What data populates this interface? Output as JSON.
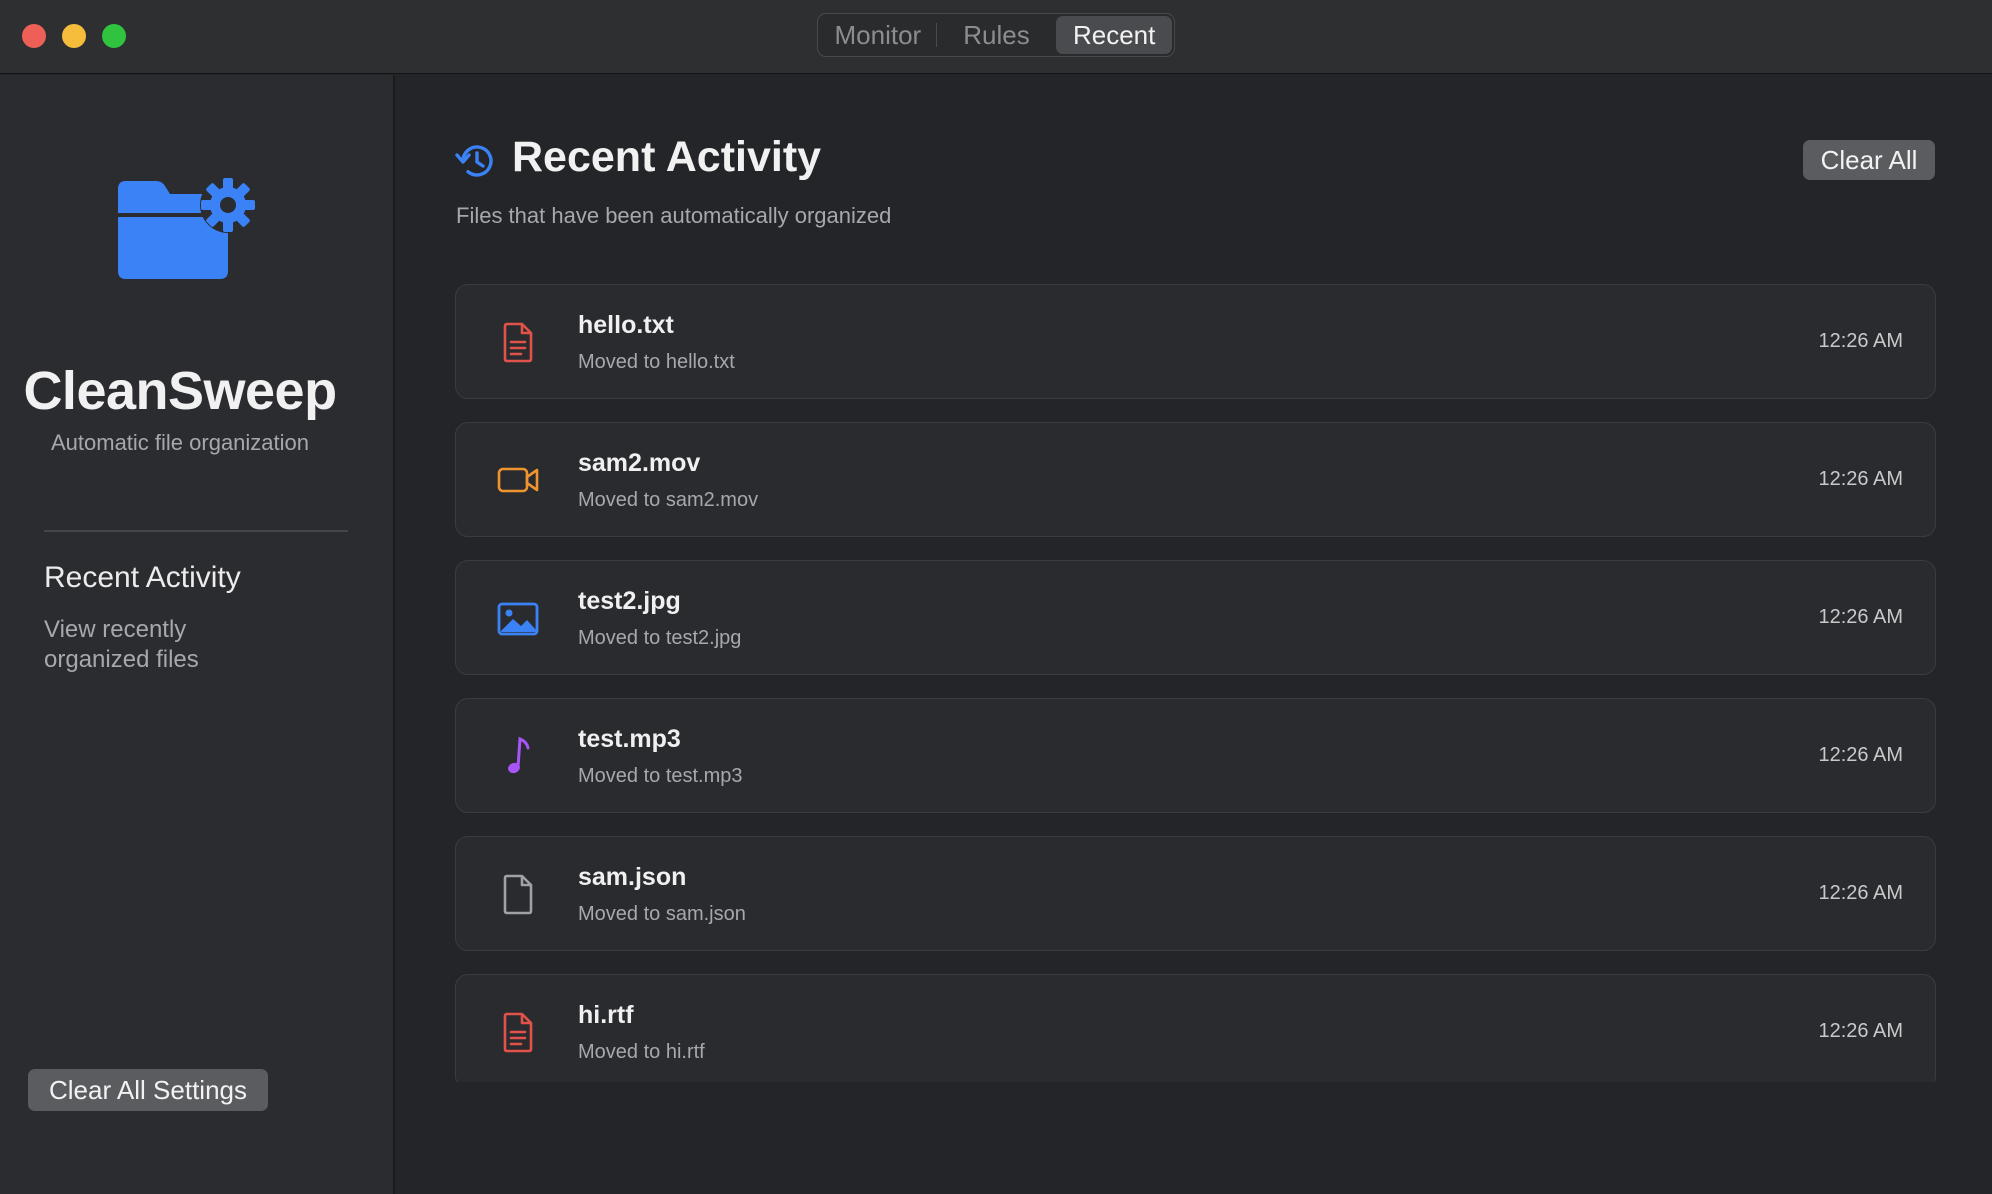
{
  "tabs": [
    {
      "label": "Monitor",
      "selected": false
    },
    {
      "label": "Rules",
      "selected": false
    },
    {
      "label": "Recent",
      "selected": true
    }
  ],
  "sidebar": {
    "app_name": "CleanSweep",
    "app_tagline": "Automatic file organization",
    "section_title": "Recent Activity",
    "section_description": "View recently organized files",
    "clear_settings_label": "Clear All Settings",
    "icon": "folder-gear-icon"
  },
  "main": {
    "title": "Recent Activity",
    "subtitle": "Files that have been automatically organized",
    "clear_all_label": "Clear All",
    "header_icon": "history-icon"
  },
  "activity": [
    {
      "name": "hello.txt",
      "moved": "Moved to hello.txt",
      "time": "12:26 AM",
      "icon": "text-file-icon",
      "color": "#e0524a"
    },
    {
      "name": "sam2.mov",
      "moved": "Moved to sam2.mov",
      "time": "12:26 AM",
      "icon": "video-icon",
      "color": "#f0942f"
    },
    {
      "name": "test2.jpg",
      "moved": "Moved to test2.jpg",
      "time": "12:26 AM",
      "icon": "image-icon",
      "color": "#3b82f6"
    },
    {
      "name": "test.mp3",
      "moved": "Moved to test.mp3",
      "time": "12:26 AM",
      "icon": "music-note-icon",
      "color": "#a855f7"
    },
    {
      "name": "sam.json",
      "moved": "Moved to sam.json",
      "time": "12:26 AM",
      "icon": "file-icon",
      "color": "#a0a1a4"
    },
    {
      "name": "hi.rtf",
      "moved": "Moved to hi.rtf",
      "time": "12:26 AM",
      "icon": "text-file-icon",
      "color": "#e0524a"
    }
  ],
  "colors": {
    "accent": "#3b82f6",
    "background": "#242528",
    "sidebar": "#2b2c30"
  }
}
